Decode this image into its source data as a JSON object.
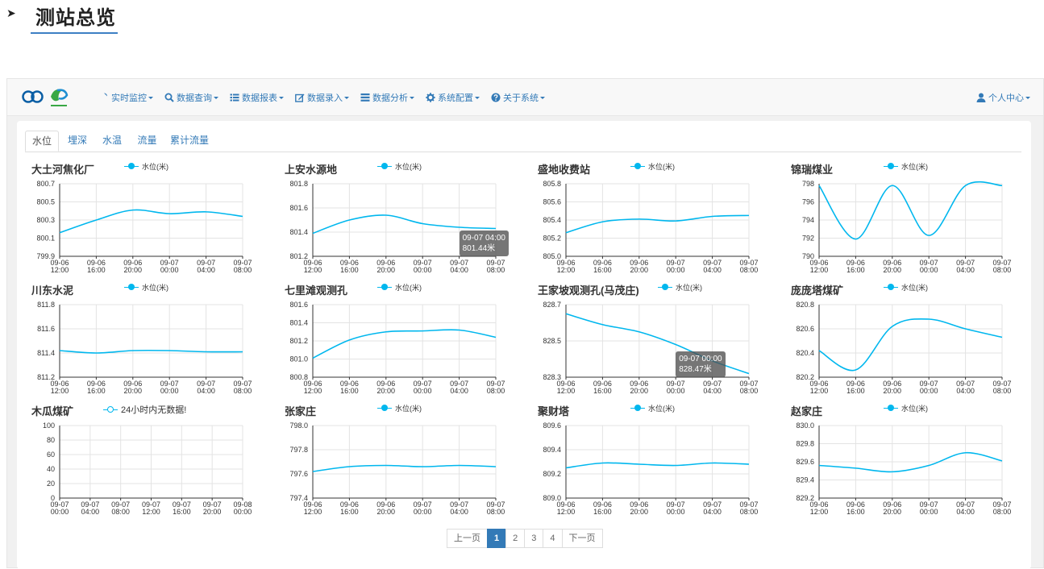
{
  "page": {
    "heading": "测站总览"
  },
  "navbar": {
    "menu": [
      {
        "label": "实时监控",
        "icon": "map-marker-icon"
      },
      {
        "label": "数据查询",
        "icon": "search-icon"
      },
      {
        "label": "数据报表",
        "icon": "list-icon"
      },
      {
        "label": "数据录入",
        "icon": "edit-icon"
      },
      {
        "label": "数据分析",
        "icon": "tasks-icon"
      },
      {
        "label": "系统配置",
        "icon": "gear-icon"
      },
      {
        "label": "关于系统",
        "icon": "question-icon"
      }
    ],
    "user_center": "个人中心",
    "accent": "#337ab7"
  },
  "tabs": [
    "水位",
    "埋深",
    "水温",
    "流量",
    "累计流量"
  ],
  "series_color": "#00b7ee",
  "chart_data": [
    {
      "type": "line",
      "title": "大土河焦化厂",
      "series": [
        {
          "name": "水位(米)",
          "values": [
            800.16,
            800.3,
            800.41,
            800.37,
            800.39,
            800.34
          ]
        }
      ],
      "x": [
        "09-06 12:00",
        "09-06 16:00",
        "09-06 20:00",
        "09-07 00:00",
        "09-07 04:00",
        "09-07 08:00"
      ],
      "yticks": [
        "799.9",
        "800.1",
        "800.3",
        "800.5",
        "800.7"
      ],
      "ylim": [
        799.9,
        800.7
      ]
    },
    {
      "type": "line",
      "title": "上安水源地",
      "series": [
        {
          "name": "水位(米)",
          "values": [
            801.39,
            801.5,
            801.54,
            801.47,
            801.44,
            801.43
          ]
        }
      ],
      "x": [
        "09-06 12:00",
        "09-06 16:00",
        "09-06 20:00",
        "09-07 00:00",
        "09-07 04:00",
        "09-07 08:00"
      ],
      "yticks": [
        "801.2",
        "801.4",
        "801.6",
        "801.8"
      ],
      "ylim": [
        801.2,
        801.8
      ],
      "tooltip": {
        "x": "09-07 04:00",
        "value": "801.44米"
      }
    },
    {
      "type": "line",
      "title": "盛地收费站",
      "series": [
        {
          "name": "水位(米)",
          "values": [
            805.26,
            805.38,
            805.41,
            805.39,
            805.44,
            805.45
          ]
        }
      ],
      "x": [
        "09-06 12:00",
        "09-06 16:00",
        "09-06 20:00",
        "09-07 00:00",
        "09-07 04:00",
        "09-07 08:00"
      ],
      "yticks": [
        "805.0",
        "805.2",
        "805.4",
        "805.6",
        "805.8"
      ],
      "ylim": [
        805.0,
        805.8
      ]
    },
    {
      "type": "line",
      "title": "锦瑞煤业",
      "series": [
        {
          "name": "水位(米)",
          "values": [
            797.8,
            791.9,
            797.8,
            792.3,
            797.8,
            797.8
          ]
        }
      ],
      "x": [
        "09-06 12:00",
        "09-06 16:00",
        "09-06 20:00",
        "09-07 00:00",
        "09-07 04:00",
        "09-07 08:00"
      ],
      "yticks": [
        "790",
        "792",
        "794",
        "796",
        "798"
      ],
      "ylim": [
        790,
        798
      ]
    },
    {
      "type": "line",
      "title": "川东水泥",
      "series": [
        {
          "name": "水位(米)",
          "values": [
            811.42,
            811.4,
            811.42,
            811.42,
            811.41,
            811.41
          ]
        }
      ],
      "x": [
        "09-06 12:00",
        "09-06 16:00",
        "09-06 20:00",
        "09-07 00:00",
        "09-07 04:00",
        "09-07 08:00"
      ],
      "yticks": [
        "811.2",
        "811.4",
        "811.6",
        "811.8"
      ],
      "ylim": [
        811.2,
        811.8
      ]
    },
    {
      "type": "line",
      "title": "七里滩观测孔",
      "series": [
        {
          "name": "水位(米)",
          "values": [
            801.01,
            801.21,
            801.3,
            801.31,
            801.32,
            801.24
          ]
        }
      ],
      "x": [
        "09-06 12:00",
        "09-06 16:00",
        "09-06 20:00",
        "09-07 00:00",
        "09-07 04:00",
        "09-07 08:00"
      ],
      "yticks": [
        "800.8",
        "801.0",
        "801.2",
        "801.4",
        "801.6"
      ],
      "ylim": [
        800.8,
        801.6
      ]
    },
    {
      "type": "line",
      "title": "王家坡观测孔(马茂庄)",
      "series": [
        {
          "name": "水位(米)",
          "values": [
            828.65,
            828.59,
            828.55,
            828.48,
            828.39,
            828.32
          ]
        }
      ],
      "x": [
        "09-06 12:00",
        "09-06 16:00",
        "09-06 20:00",
        "09-07 00:00",
        "09-07 04:00",
        "09-07 08:00"
      ],
      "yticks": [
        "828.3",
        "828.5",
        "828.7"
      ],
      "ylim": [
        828.3,
        828.7
      ],
      "tooltip": {
        "x": "09-07 00:00",
        "value": "828.47米"
      }
    },
    {
      "type": "line",
      "title": "庞庞塔煤矿",
      "series": [
        {
          "name": "水位(米)",
          "values": [
            820.42,
            820.26,
            820.62,
            820.68,
            820.6,
            820.53
          ]
        }
      ],
      "x": [
        "09-06 12:00",
        "09-06 16:00",
        "09-06 20:00",
        "09-07 00:00",
        "09-07 04:00",
        "09-07 08:00"
      ],
      "yticks": [
        "820.2",
        "820.4",
        "820.6",
        "820.8"
      ],
      "ylim": [
        820.2,
        820.8
      ]
    },
    {
      "type": "line",
      "title": "木瓜煤矿",
      "series": [
        {
          "name": "24小时内无数据!",
          "values": []
        }
      ],
      "x": [
        "09-07 00:00",
        "09-07 04:00",
        "09-07 08:00",
        "09-07 12:00",
        "09-07 16:00",
        "09-07 20:00",
        "09-08 00:00"
      ],
      "yticks": [
        "0",
        "20",
        "40",
        "60",
        "80",
        "100"
      ],
      "ylim": [
        0,
        100
      ],
      "empty": true
    },
    {
      "type": "line",
      "title": "张家庄",
      "series": [
        {
          "name": "水位(米)",
          "values": [
            797.62,
            797.66,
            797.67,
            797.66,
            797.67,
            797.66
          ]
        }
      ],
      "x": [
        "09-06 12:00",
        "09-06 16:00",
        "09-06 20:00",
        "09-07 00:00",
        "09-07 04:00",
        "09-07 08:00"
      ],
      "yticks": [
        "797.4",
        "797.6",
        "797.8",
        "798.0"
      ],
      "ylim": [
        797.4,
        798.0
      ]
    },
    {
      "type": "line",
      "title": "聚财塔",
      "series": [
        {
          "name": "水位(米)",
          "values": [
            809.25,
            809.29,
            809.28,
            809.27,
            809.29,
            809.28
          ]
        }
      ],
      "x": [
        "09-06 12:00",
        "09-06 16:00",
        "09-06 20:00",
        "09-07 00:00",
        "09-07 04:00",
        "09-07 08:00"
      ],
      "yticks": [
        "809.0",
        "809.2",
        "809.4",
        "809.6"
      ],
      "ylim": [
        809.0,
        809.6
      ]
    },
    {
      "type": "line",
      "title": "赵家庄",
      "series": [
        {
          "name": "水位(米)",
          "values": [
            829.56,
            829.53,
            829.49,
            829.56,
            829.7,
            829.61
          ]
        }
      ],
      "x": [
        "09-06 12:00",
        "09-06 16:00",
        "09-06 20:00",
        "09-07 00:00",
        "09-07 04:00",
        "09-07 08:00"
      ],
      "yticks": [
        "829.2",
        "829.4",
        "829.6",
        "829.8",
        "830.0"
      ],
      "ylim": [
        829.2,
        830.0
      ]
    }
  ],
  "pagination": {
    "prev": "上一页",
    "pages": [
      "1",
      "2",
      "3",
      "4"
    ],
    "current": "1",
    "next": "下一页"
  }
}
